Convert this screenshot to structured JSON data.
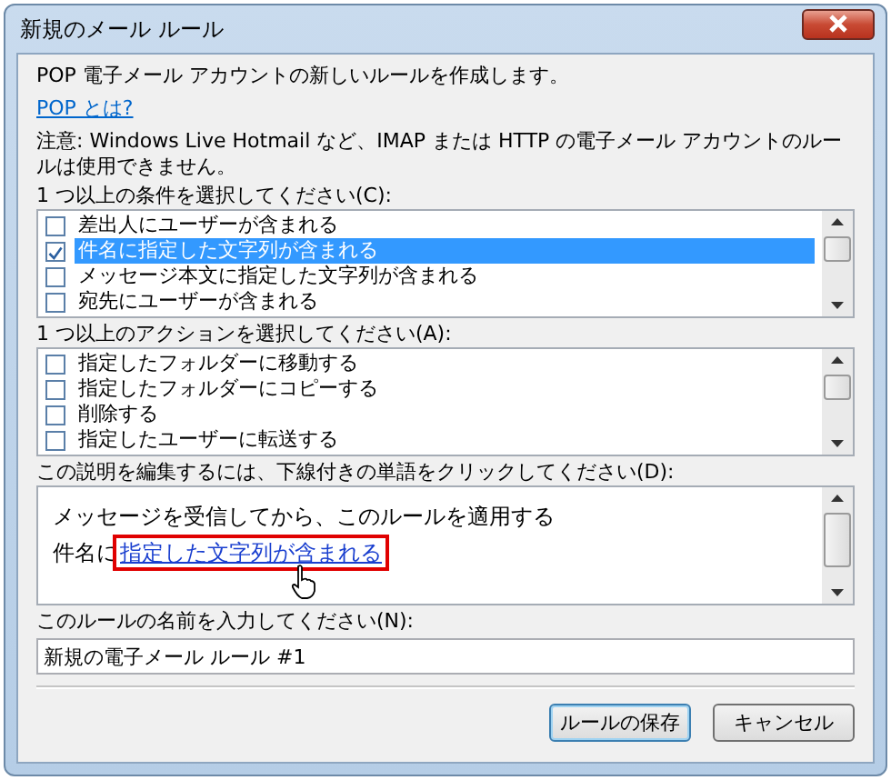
{
  "window": {
    "title": "新規のメール ルール"
  },
  "intro": "POP 電子メール アカウントの新しいルールを作成します。",
  "help_link": "POP とは?",
  "note": "注意: Windows Live Hotmail など、IMAP または HTTP の電子メール アカウントのルールは使用できません。",
  "conditions": {
    "label": "1 つ以上の条件を選択してください(C):",
    "items": [
      {
        "label": "差出人にユーザーが含まれる",
        "checked": false,
        "selected": false
      },
      {
        "label": "件名に指定した文字列が含まれる",
        "checked": true,
        "selected": true
      },
      {
        "label": "メッセージ本文に指定した文字列が含まれる",
        "checked": false,
        "selected": false
      },
      {
        "label": "宛先にユーザーが含まれる",
        "checked": false,
        "selected": false
      }
    ]
  },
  "actions": {
    "label": "1 つ以上のアクションを選択してください(A):",
    "items": [
      {
        "label": "指定したフォルダーに移動する",
        "checked": false,
        "selected": false
      },
      {
        "label": "指定したフォルダーにコピーする",
        "checked": false,
        "selected": false
      },
      {
        "label": "削除する",
        "checked": false,
        "selected": false
      },
      {
        "label": "指定したユーザーに転送する",
        "checked": false,
        "selected": false
      }
    ]
  },
  "description": {
    "label": "この説明を編集するには、下線付きの単語をクリックしてください(D):",
    "line": "メッセージを受信してから、このルールを適用する",
    "prefix": "件名に",
    "link": "指定した文字列が含まれる",
    "highlighted": true
  },
  "rule_name": {
    "label": "このルールの名前を入力してください(N):",
    "value": "新規の電子メール ルール #1"
  },
  "buttons": [
    {
      "label": "ルールの保存",
      "default": true
    },
    {
      "label": "キャンセル",
      "default": false
    }
  ]
}
